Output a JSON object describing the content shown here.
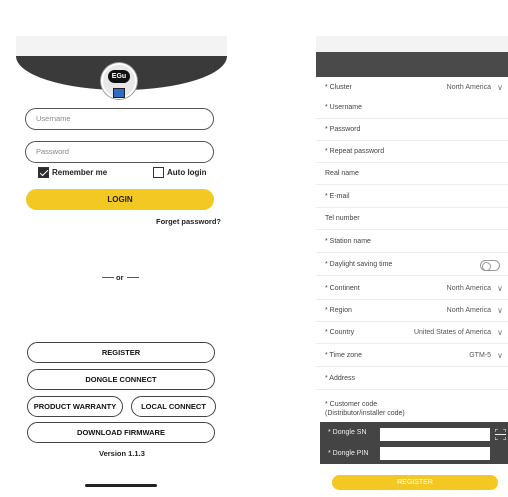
{
  "login": {
    "logo_text": "EGu",
    "username_placeholder": "Username",
    "password_placeholder": "Password",
    "remember_me": "Remember me",
    "remember_me_checked": true,
    "auto_login": "Auto login",
    "auto_login_checked": false,
    "login_button": "LOGIN",
    "forget_password": "Forget password?",
    "or_label": "or",
    "register_button": "REGISTER",
    "dongle_connect_button": "DONGLE CONNECT",
    "product_warranty_button": "PRODUCT WARRANTY",
    "local_connect_button": "LOCAL CONNECT",
    "download_firmware_button": "DOWNLOAD FIRMWARE",
    "version": "Version 1.1.3"
  },
  "register": {
    "fields": [
      {
        "label": "* Cluster",
        "value": "North America",
        "dropdown": true
      },
      {
        "label": "* Username",
        "value": ""
      },
      {
        "label": "* Password",
        "value": ""
      },
      {
        "label": "* Repeat password",
        "value": ""
      },
      {
        "label": "Real name",
        "value": ""
      },
      {
        "label": "* E-mail",
        "value": ""
      },
      {
        "label": "Tel number",
        "value": ""
      },
      {
        "label": "* Station name",
        "value": ""
      },
      {
        "label": "* Daylight saving time",
        "value": "",
        "toggle": false
      },
      {
        "label": "* Continent",
        "value": "North America",
        "dropdown": true
      },
      {
        "label": "* Region",
        "value": "North America",
        "dropdown": true
      },
      {
        "label": "* Country",
        "value": "United States of America",
        "dropdown": true
      },
      {
        "label": "* Time zone",
        "value": "GTM-5",
        "dropdown": true
      },
      {
        "label": "* Address",
        "value": ""
      }
    ],
    "customer_code_label": "* Customer code",
    "customer_code_sub": "(Distributor/installer code)",
    "dongle_sn_label": "* Dongle SN",
    "dongle_pin_label": "* Dongle PIN",
    "register_button": "REGISTER"
  },
  "colors": {
    "accent": "#f3c823",
    "header_dark": "#3a3a3a",
    "dongle_panel": "#444444"
  }
}
